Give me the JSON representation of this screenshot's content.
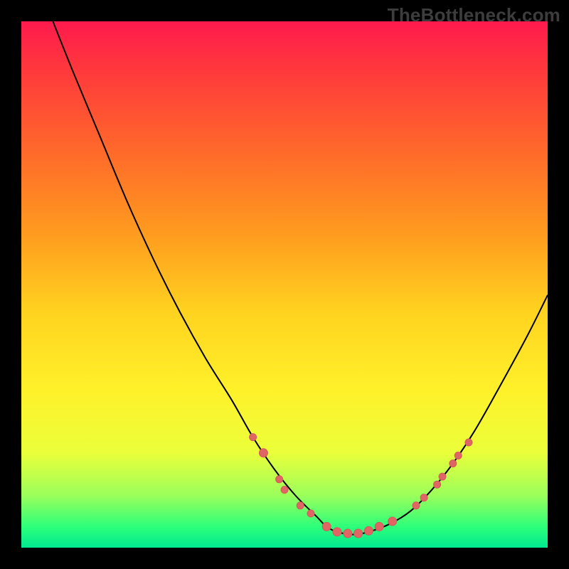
{
  "watermark": "TheBottleneck.com",
  "chart_data": {
    "type": "line",
    "title": "",
    "xlabel": "",
    "ylabel": "",
    "xlim": [
      0,
      100
    ],
    "ylim": [
      0,
      100
    ],
    "series": [
      {
        "name": "bottleneck-curve",
        "x": [
          6,
          10,
          15,
          20,
          25,
          30,
          35,
          40,
          44,
          48,
          52,
          56,
          58,
          60,
          63,
          66,
          70,
          74,
          78,
          82,
          86,
          90,
          96,
          100
        ],
        "y": [
          100,
          90,
          78,
          66,
          55,
          45,
          36,
          28,
          21,
          15,
          10,
          6,
          4,
          3,
          2.5,
          3,
          4.5,
          7,
          11,
          16,
          22,
          29,
          40,
          48
        ]
      }
    ],
    "markers": [
      {
        "x": 44,
        "y": 21,
        "r": 5
      },
      {
        "x": 46,
        "y": 18,
        "r": 6
      },
      {
        "x": 49,
        "y": 13,
        "r": 5
      },
      {
        "x": 50,
        "y": 11,
        "r": 5
      },
      {
        "x": 53,
        "y": 8,
        "r": 5
      },
      {
        "x": 55,
        "y": 6.5,
        "r": 5
      },
      {
        "x": 58,
        "y": 4,
        "r": 6
      },
      {
        "x": 60,
        "y": 3,
        "r": 6
      },
      {
        "x": 62,
        "y": 2.7,
        "r": 6
      },
      {
        "x": 64,
        "y": 2.7,
        "r": 6
      },
      {
        "x": 66,
        "y": 3.2,
        "r": 6
      },
      {
        "x": 68,
        "y": 4,
        "r": 6
      },
      {
        "x": 70.5,
        "y": 5,
        "r": 6
      },
      {
        "x": 75,
        "y": 8,
        "r": 5
      },
      {
        "x": 76.5,
        "y": 9.5,
        "r": 5
      },
      {
        "x": 79,
        "y": 12,
        "r": 5
      },
      {
        "x": 80,
        "y": 13.5,
        "r": 5
      },
      {
        "x": 82,
        "y": 16,
        "r": 5
      },
      {
        "x": 83,
        "y": 17.5,
        "r": 5
      },
      {
        "x": 85,
        "y": 20,
        "r": 5
      }
    ],
    "colors": {
      "curve": "#000000",
      "marker_fill": "#e06666",
      "marker_stroke": "#d45a5a"
    }
  }
}
